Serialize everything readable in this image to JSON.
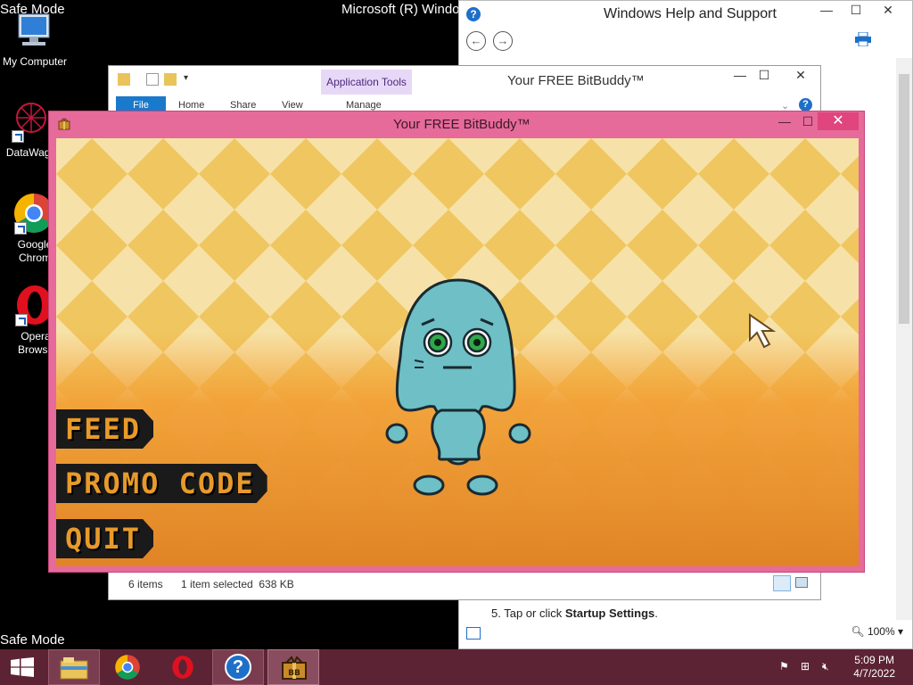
{
  "desktop": {
    "safe_mode_top": "Safe Mode",
    "safe_mode_bottom": "Safe Mode",
    "os_version": "Microsoft (R) Windo",
    "icons": [
      {
        "label": "My Computer",
        "icon": "computer-icon"
      },
      {
        "label": "DataWago",
        "icon": "datawagon-icon"
      },
      {
        "label": "Google Chrom",
        "icon": "chrome-icon"
      },
      {
        "label": "Opera Browse",
        "icon": "opera-icon"
      }
    ]
  },
  "help_window": {
    "title": "Windows Help and Support",
    "step_prefix": "5.  Tap or click ",
    "step_bold": "Startup Settings",
    "step_suffix": ".",
    "zoom": "100%",
    "controls": {
      "minimize": "—",
      "maximize": "☐",
      "close": "✕"
    }
  },
  "explorer": {
    "title": "Your FREE BitBuddy™",
    "app_tools_label": "Application Tools",
    "tabs": [
      "File",
      "Home",
      "Share",
      "View",
      "Manage"
    ],
    "status_items": "6 items",
    "status_selected": "1 item selected  638 KB"
  },
  "bitbuddy": {
    "title": "Your FREE BitBuddy™",
    "menu": {
      "feed": "FEED",
      "promo": "PROMO CODE",
      "quit": "QUIT"
    },
    "colors": {
      "frame": "#e66a9a",
      "menu_text": "#e89a2a",
      "buddy": "#6ebfc6"
    }
  },
  "taskbar": {
    "time": "5:09 PM",
    "date": "4/7/2022",
    "apps": [
      "windows-start-icon",
      "file-explorer-icon",
      "chrome-icon",
      "opera-icon",
      "help-icon",
      "bitbuddy-icon"
    ]
  }
}
